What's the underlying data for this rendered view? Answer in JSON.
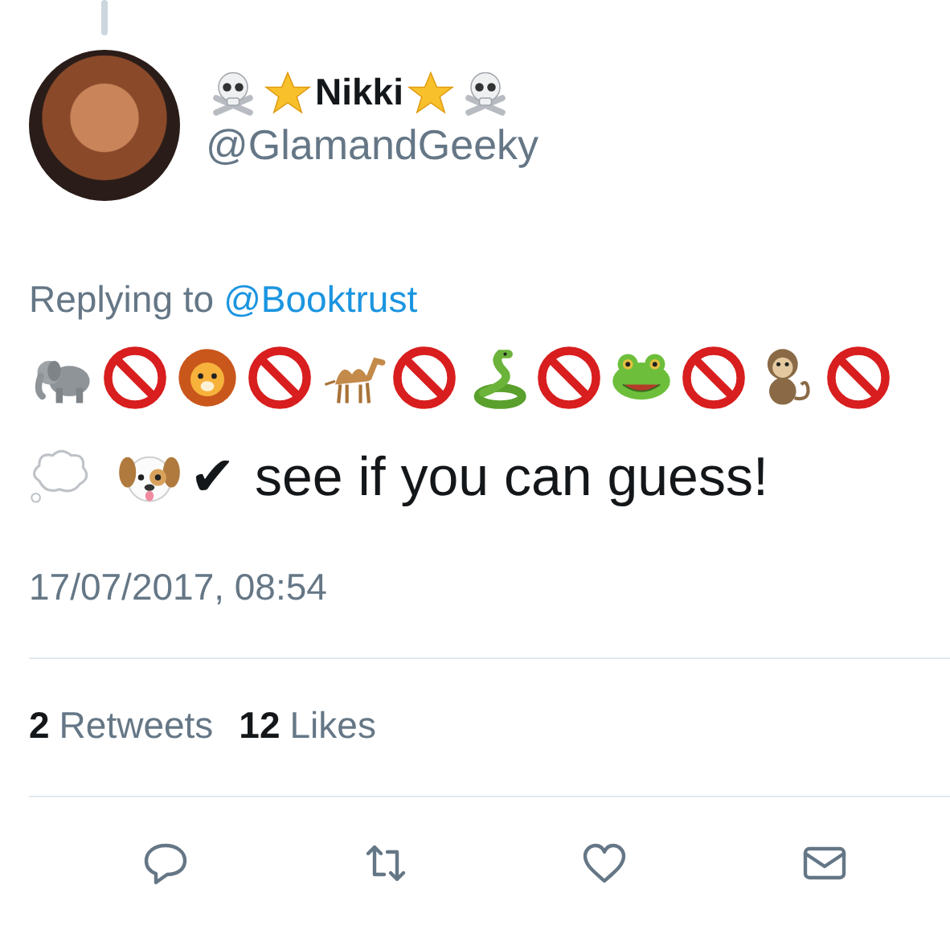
{
  "author": {
    "name": "Nikki",
    "name_before": [
      {
        "kind": "skull"
      },
      {
        "kind": "star"
      }
    ],
    "name_after": [
      {
        "kind": "star"
      },
      {
        "kind": "skull"
      }
    ],
    "handle": "@GlamandGeeky"
  },
  "reply": {
    "prefix": "Replying to",
    "mention": "@Booktrust"
  },
  "emoji_row": [
    {
      "kind": "elephant"
    },
    {
      "kind": "prohibited"
    },
    {
      "kind": "lion"
    },
    {
      "kind": "prohibited"
    },
    {
      "kind": "camel"
    },
    {
      "kind": "prohibited"
    },
    {
      "kind": "snake"
    },
    {
      "kind": "prohibited"
    },
    {
      "kind": "frog"
    },
    {
      "kind": "prohibited"
    },
    {
      "kind": "monkey"
    },
    {
      "kind": "prohibited"
    }
  ],
  "body": {
    "emoji_before": [
      {
        "kind": "thought"
      },
      {
        "kind": "dog"
      }
    ],
    "check": "✔",
    "text": "see if you can guess!"
  },
  "timestamp": "17/07/2017, 08:54",
  "stats": [
    {
      "count": "2",
      "label": "Retweets"
    },
    {
      "count": "12",
      "label": "Likes"
    }
  ],
  "actions": [
    {
      "kind": "reply"
    },
    {
      "kind": "retweet"
    },
    {
      "kind": "like"
    },
    {
      "kind": "message"
    }
  ]
}
